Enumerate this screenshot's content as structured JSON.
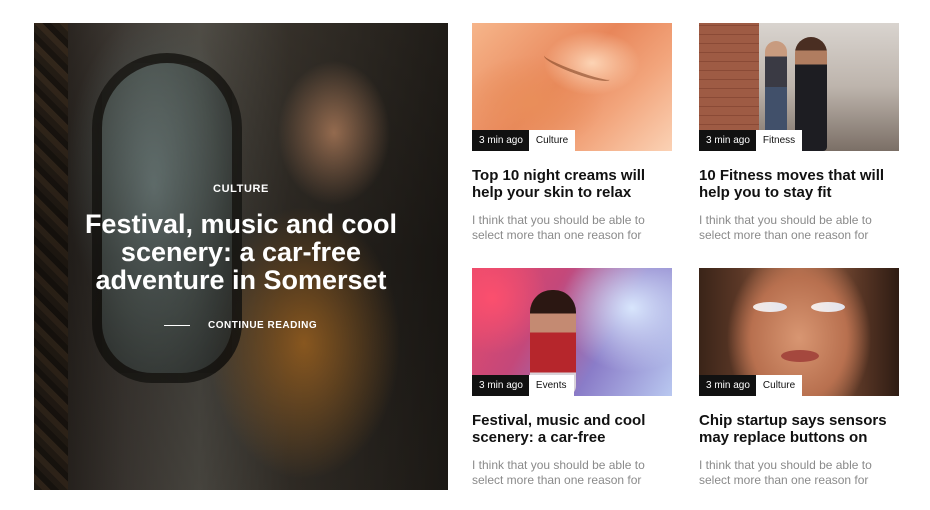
{
  "hero": {
    "category": "CULTURE",
    "title": "Festival, music and cool scenery: a car-free adventure in Somerset",
    "cta_label": "CONTINUE READING"
  },
  "cards": [
    {
      "time": "3 min ago",
      "category": "Culture",
      "title": "Top 10 night creams will help your skin to relax",
      "excerpt": "I think that you should be able to select more than one reason for"
    },
    {
      "time": "3 min ago",
      "category": "Fitness",
      "title": "10 Fitness moves that will help you to stay fit",
      "excerpt": "I think that you should be able to select more than one reason for"
    },
    {
      "time": "3 min ago",
      "category": "Events",
      "title": "Festival, music and cool scenery: a car-free",
      "excerpt": "I think that you should be able to select more than one reason for"
    },
    {
      "time": "3 min ago",
      "category": "Culture",
      "title": "Chip startup says sensors may replace buttons on",
      "excerpt": "I think that you should be able to select more than one reason for"
    }
  ]
}
